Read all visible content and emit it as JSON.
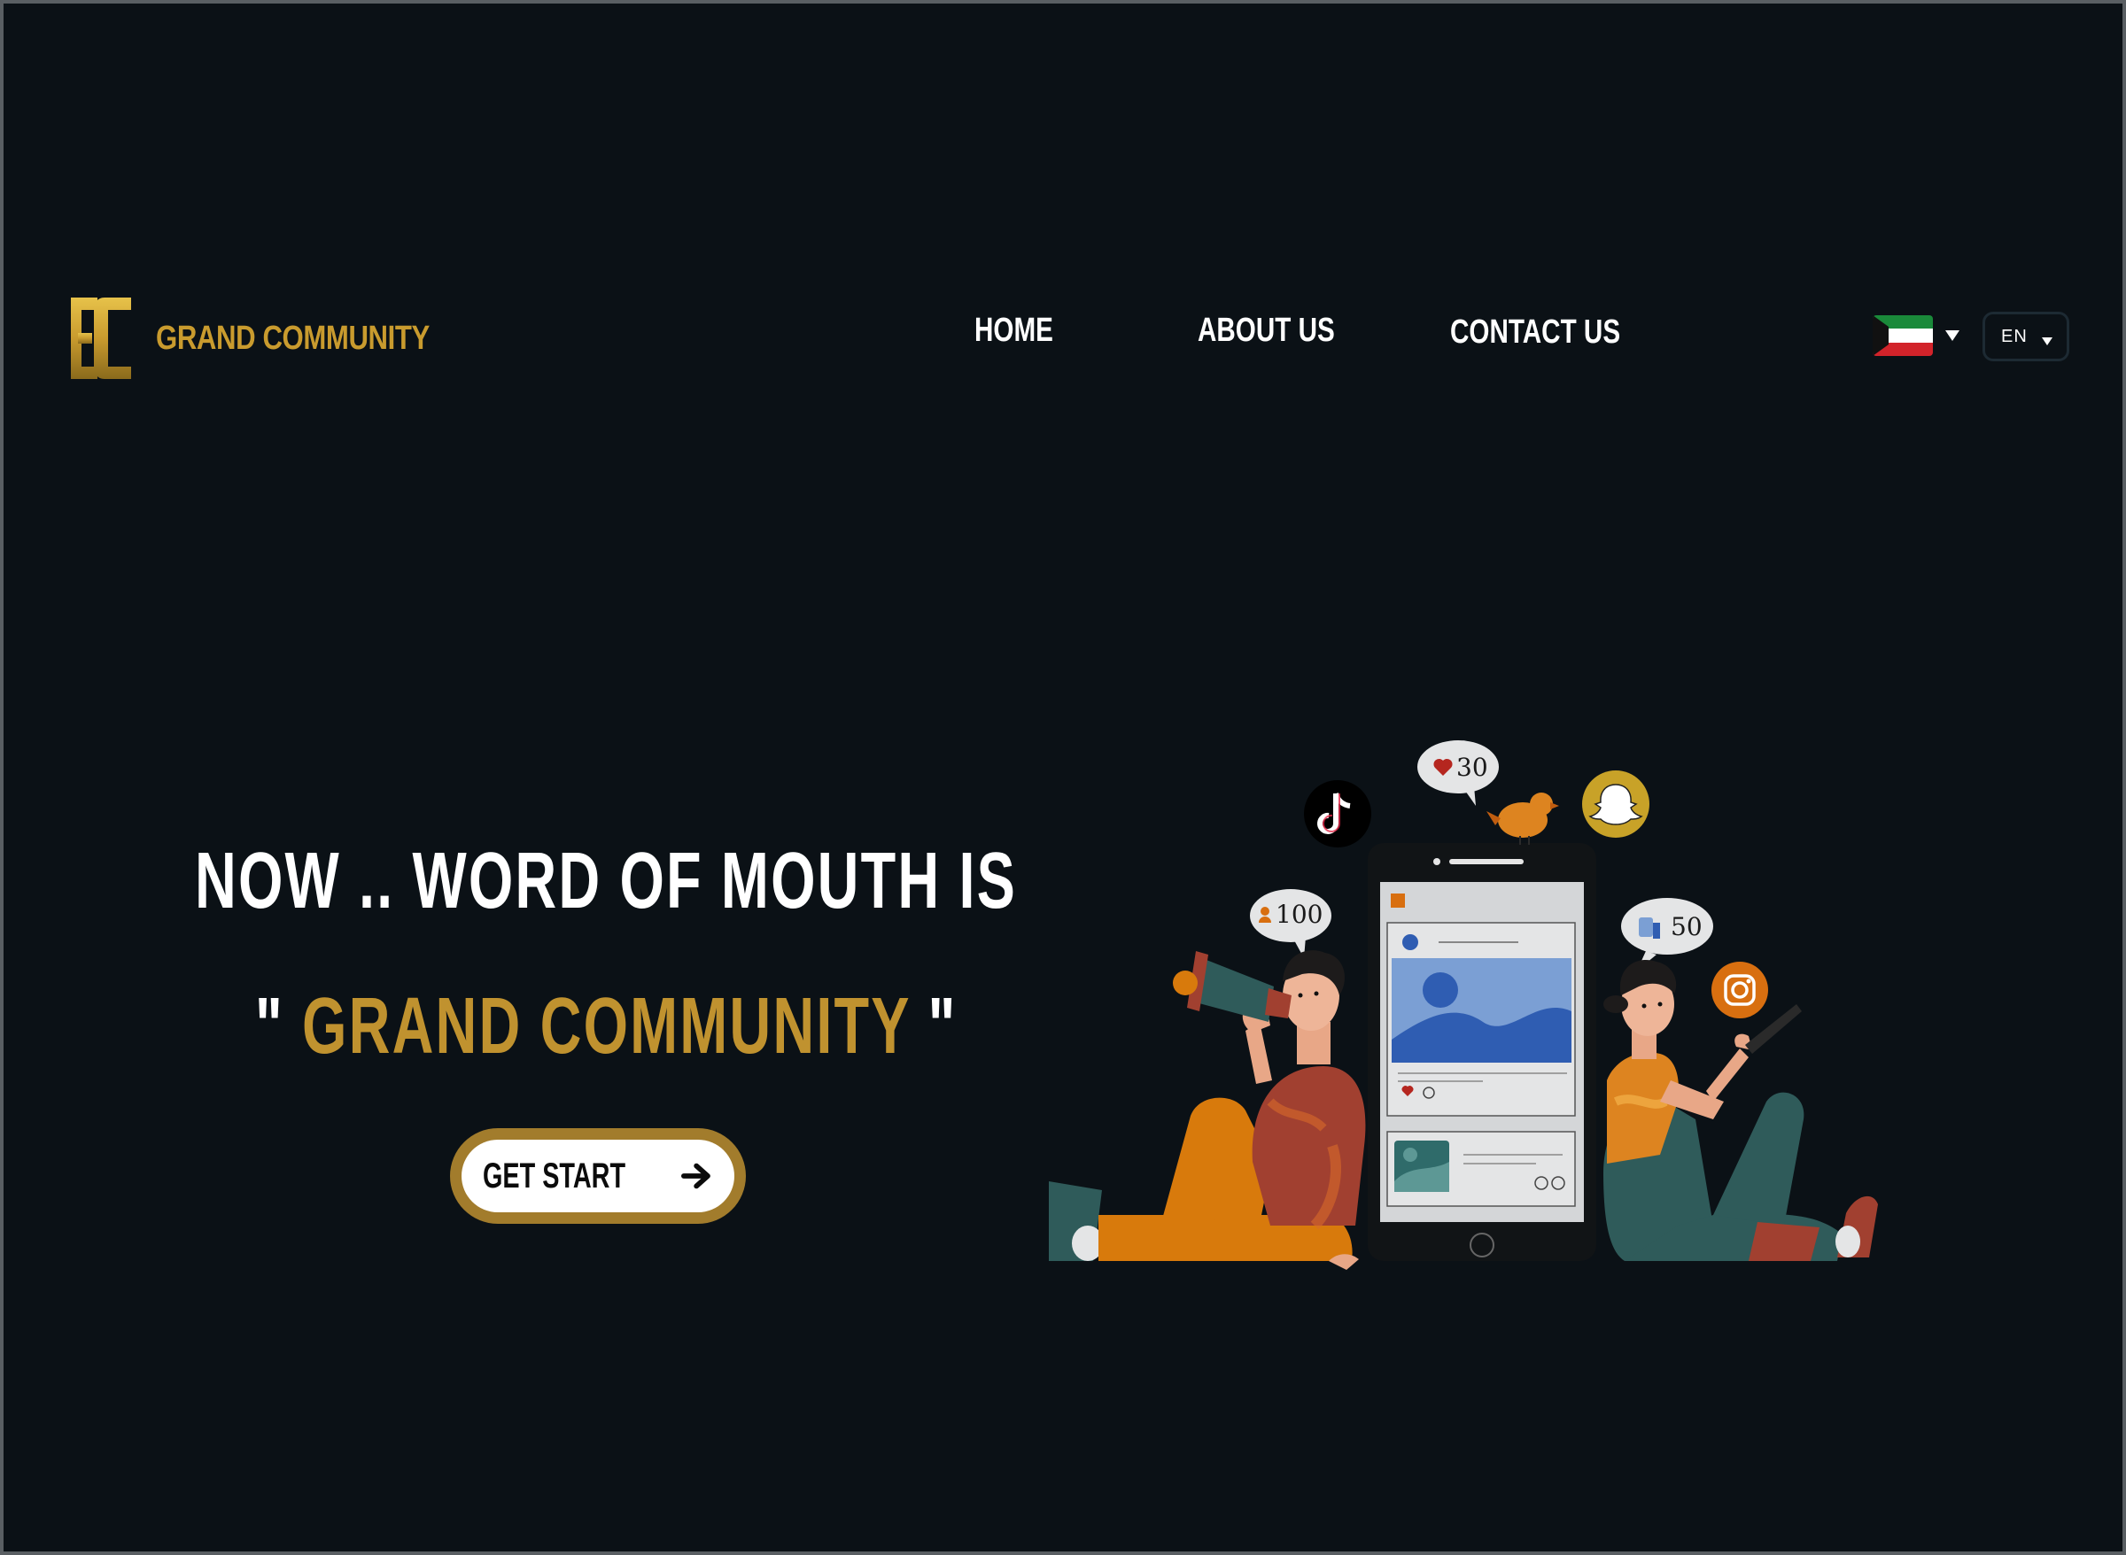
{
  "brand": {
    "name": "GRAND COMMUNITY",
    "logo_icon": "gc-monogram-logo",
    "gold_color": "#c99b2e"
  },
  "nav": {
    "items": [
      {
        "label": "HOME"
      },
      {
        "label": "ABOUT US"
      },
      {
        "label": "CONTACT US"
      }
    ]
  },
  "language": {
    "flag_icon": "kuwait-flag-icon",
    "selected": "EN"
  },
  "hero": {
    "line1": "NOW .. WORD OF MOUTH IS",
    "quote_open": "\"",
    "highlight": "GRAND COMMUNITY",
    "quote_close": "\"",
    "cta_label": "GET START",
    "cta_icon": "arrow-right-icon"
  },
  "illustration": {
    "likes": "30",
    "followers": "100",
    "thumbs": "50",
    "icons": [
      "tiktok-icon",
      "snapchat-icon",
      "instagram-icon",
      "bird-icon",
      "megaphone-icon",
      "phone-icon"
    ]
  },
  "colors": {
    "background": "#0b1116",
    "accent_gold": "#c0922f",
    "button_ring": "#a27c2c"
  }
}
